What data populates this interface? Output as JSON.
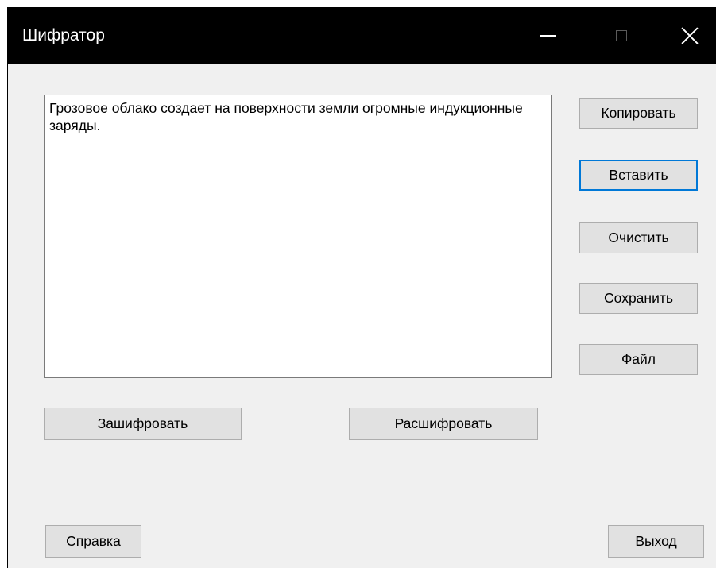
{
  "window": {
    "title": "Шифратор"
  },
  "editor": {
    "text": "Грозовое облако создает на поверхности земли огромные индукционные заряды."
  },
  "side_buttons": {
    "copy": "Копировать",
    "paste": "Вставить",
    "clear": "Очистить",
    "save": "Сохранить",
    "file": "Файл"
  },
  "actions": {
    "encrypt": "Зашифровать",
    "decrypt": "Расшифровать"
  },
  "footer": {
    "help": "Справка",
    "exit": "Выход"
  },
  "colors": {
    "titlebar": "#000000",
    "window_bg": "#f0f0f0",
    "button_bg": "#e1e1e1",
    "focus_accent": "#0078d7"
  },
  "icons": {
    "minimize": "minimize-icon",
    "maximize": "maximize-icon",
    "close": "close-icon"
  }
}
